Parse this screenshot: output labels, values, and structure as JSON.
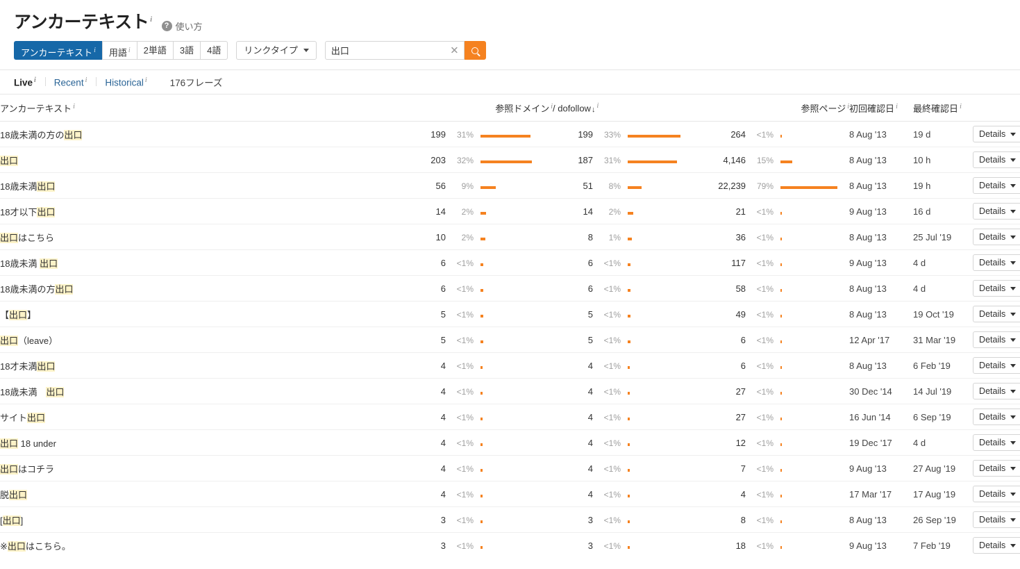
{
  "header": {
    "title": "アンカーテキスト",
    "info_marker": "i",
    "help_icon": "?",
    "help_label": "使い方"
  },
  "filters": {
    "segments": [
      {
        "label": "アンカーテキスト",
        "info": "i",
        "active": true
      },
      {
        "label": "用語",
        "info": "i",
        "active": false
      },
      {
        "label": "2単語",
        "info": "",
        "active": false
      },
      {
        "label": "3語",
        "info": "",
        "active": false
      },
      {
        "label": "4語",
        "info": "",
        "active": false
      }
    ],
    "link_type_label": "リンクタイプ",
    "search_value": "出口",
    "search_placeholder": "",
    "clear_icon": "✕",
    "search_icon": "search-icon"
  },
  "subbar": {
    "tabs": [
      {
        "label": "Live",
        "info": "i",
        "active": true
      },
      {
        "label": "Recent",
        "info": "i",
        "active": false
      },
      {
        "label": "Historical",
        "info": "i",
        "active": false
      }
    ],
    "phrase_count": "176フレーズ"
  },
  "table": {
    "columns": {
      "anchor": "アンカーテキスト",
      "ref_domains": "参照ドメイン",
      "dofollow": "/ dofollow",
      "dofollow_sort": "↓",
      "ref_pages": "参照ページ",
      "first_seen": "初回確認日",
      "last_seen": "最終確認日",
      "info": "i"
    },
    "details_label": "Details",
    "highlight_term": "出口",
    "rows": [
      {
        "anchor_pre": "18歳未満の方の",
        "anchor_hl": "出口",
        "anchor_post": "",
        "rd": "199",
        "rd_pct": "31%",
        "rd_bar": 72,
        "df": "199",
        "df_pct": "33%",
        "df_bar": 76,
        "rp": "264",
        "rp_pct": "<1%",
        "rp_bar": 2,
        "first": "8 Aug '13",
        "last": "19 d"
      },
      {
        "anchor_pre": "",
        "anchor_hl": "出口",
        "anchor_post": "",
        "rd": "203",
        "rd_pct": "32%",
        "rd_bar": 74,
        "df": "187",
        "df_pct": "31%",
        "df_bar": 71,
        "rp": "4,146",
        "rp_pct": "15%",
        "rp_bar": 17,
        "first": "8 Aug '13",
        "last": "10 h"
      },
      {
        "anchor_pre": "18歳未満",
        "anchor_hl": "出口",
        "anchor_post": "",
        "rd": "56",
        "rd_pct": "9%",
        "rd_bar": 22,
        "df": "51",
        "df_pct": "8%",
        "df_bar": 20,
        "rp": "22,239",
        "rp_pct": "79%",
        "rp_bar": 82,
        "first": "8 Aug '13",
        "last": "19 h"
      },
      {
        "anchor_pre": "18才以下",
        "anchor_hl": "出口",
        "anchor_post": "",
        "rd": "14",
        "rd_pct": "2%",
        "rd_bar": 8,
        "df": "14",
        "df_pct": "2%",
        "df_bar": 8,
        "rp": "21",
        "rp_pct": "<1%",
        "rp_bar": 2,
        "first": "9 Aug '13",
        "last": "16 d"
      },
      {
        "anchor_pre": "",
        "anchor_hl": "出口",
        "anchor_post": "はこちら",
        "rd": "10",
        "rd_pct": "2%",
        "rd_bar": 7,
        "df": "8",
        "df_pct": "1%",
        "df_bar": 6,
        "rp": "36",
        "rp_pct": "<1%",
        "rp_bar": 2,
        "first": "8 Aug '13",
        "last": "25 Jul '19"
      },
      {
        "anchor_pre": "18歳未満 ",
        "anchor_hl": "出口",
        "anchor_post": "",
        "rd": "6",
        "rd_pct": "<1%",
        "rd_bar": 4,
        "df": "6",
        "df_pct": "<1%",
        "df_bar": 4,
        "rp": "117",
        "rp_pct": "<1%",
        "rp_bar": 2,
        "first": "9 Aug '13",
        "last": "4 d"
      },
      {
        "anchor_pre": "18歳未満の方",
        "anchor_hl": "出口",
        "anchor_post": "",
        "rd": "6",
        "rd_pct": "<1%",
        "rd_bar": 4,
        "df": "6",
        "df_pct": "<1%",
        "df_bar": 4,
        "rp": "58",
        "rp_pct": "<1%",
        "rp_bar": 2,
        "first": "8 Aug '13",
        "last": "4 d"
      },
      {
        "anchor_pre": "【",
        "anchor_hl": "出口",
        "anchor_post": "】",
        "rd": "5",
        "rd_pct": "<1%",
        "rd_bar": 4,
        "df": "5",
        "df_pct": "<1%",
        "df_bar": 4,
        "rp": "49",
        "rp_pct": "<1%",
        "rp_bar": 2,
        "first": "8 Aug '13",
        "last": "19 Oct '19"
      },
      {
        "anchor_pre": "",
        "anchor_hl": "出口",
        "anchor_post": "（leave）",
        "rd": "5",
        "rd_pct": "<1%",
        "rd_bar": 4,
        "df": "5",
        "df_pct": "<1%",
        "df_bar": 4,
        "rp": "6",
        "rp_pct": "<1%",
        "rp_bar": 2,
        "first": "12 Apr '17",
        "last": "31 Mar '19"
      },
      {
        "anchor_pre": "18才未満",
        "anchor_hl": "出口",
        "anchor_post": "",
        "rd": "4",
        "rd_pct": "<1%",
        "rd_bar": 3,
        "df": "4",
        "df_pct": "<1%",
        "df_bar": 3,
        "rp": "6",
        "rp_pct": "<1%",
        "rp_bar": 2,
        "first": "8 Aug '13",
        "last": "6 Feb '19"
      },
      {
        "anchor_pre": "18歳未満　",
        "anchor_hl": "出口",
        "anchor_post": "",
        "rd": "4",
        "rd_pct": "<1%",
        "rd_bar": 3,
        "df": "4",
        "df_pct": "<1%",
        "df_bar": 3,
        "rp": "27",
        "rp_pct": "<1%",
        "rp_bar": 2,
        "first": "30 Dec '14",
        "last": "14 Jul '19"
      },
      {
        "anchor_pre": "サイト",
        "anchor_hl": "出口",
        "anchor_post": "",
        "rd": "4",
        "rd_pct": "<1%",
        "rd_bar": 3,
        "df": "4",
        "df_pct": "<1%",
        "df_bar": 3,
        "rp": "27",
        "rp_pct": "<1%",
        "rp_bar": 2,
        "first": "16 Jun '14",
        "last": "6 Sep '19"
      },
      {
        "anchor_pre": "",
        "anchor_hl": "出口",
        "anchor_post": " 18 under",
        "rd": "4",
        "rd_pct": "<1%",
        "rd_bar": 3,
        "df": "4",
        "df_pct": "<1%",
        "df_bar": 3,
        "rp": "12",
        "rp_pct": "<1%",
        "rp_bar": 2,
        "first": "19 Dec '17",
        "last": "4 d"
      },
      {
        "anchor_pre": "",
        "anchor_hl": "出口",
        "anchor_post": "はコチラ",
        "rd": "4",
        "rd_pct": "<1%",
        "rd_bar": 3,
        "df": "4",
        "df_pct": "<1%",
        "df_bar": 3,
        "rp": "7",
        "rp_pct": "<1%",
        "rp_bar": 2,
        "first": "9 Aug '13",
        "last": "27 Aug '19"
      },
      {
        "anchor_pre": "脱",
        "anchor_hl": "出口",
        "anchor_post": "",
        "rd": "4",
        "rd_pct": "<1%",
        "rd_bar": 3,
        "df": "4",
        "df_pct": "<1%",
        "df_bar": 3,
        "rp": "4",
        "rp_pct": "<1%",
        "rp_bar": 2,
        "first": "17 Mar '17",
        "last": "17 Aug '19"
      },
      {
        "anchor_pre": "[",
        "anchor_hl": "出口",
        "anchor_post": "]",
        "rd": "3",
        "rd_pct": "<1%",
        "rd_bar": 3,
        "df": "3",
        "df_pct": "<1%",
        "df_bar": 3,
        "rp": "8",
        "rp_pct": "<1%",
        "rp_bar": 2,
        "first": "8 Aug '13",
        "last": "26 Sep '19"
      },
      {
        "anchor_pre": "※",
        "anchor_hl": "出口",
        "anchor_post": "はこちら。",
        "rd": "3",
        "rd_pct": "<1%",
        "rd_bar": 3,
        "df": "3",
        "df_pct": "<1%",
        "df_bar": 3,
        "rp": "18",
        "rp_pct": "<1%",
        "rp_bar": 2,
        "first": "9 Aug '13",
        "last": "7 Feb '19"
      }
    ]
  },
  "colors": {
    "accent_orange": "#f58220",
    "accent_blue": "#1668a8",
    "highlight_yellow": "#fdf3c8",
    "link_blue": "#2a6496"
  }
}
